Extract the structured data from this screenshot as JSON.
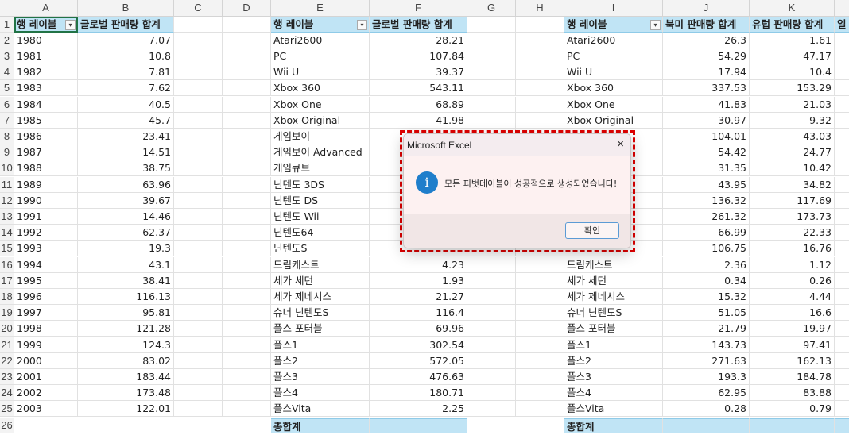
{
  "columns": [
    "A",
    "B",
    "C",
    "D",
    "E",
    "F",
    "G",
    "H",
    "I",
    "J",
    "K",
    "L"
  ],
  "row_numbers": [
    1,
    2,
    3,
    4,
    5,
    6,
    7,
    8,
    9,
    10,
    11,
    12,
    13,
    14,
    15,
    16,
    17,
    18,
    19,
    20,
    21,
    22,
    23,
    24,
    25,
    26
  ],
  "pivot1": {
    "headers": [
      "행 레이블",
      "글로벌 판매량 합계"
    ],
    "rows": [
      [
        "1980",
        "7.07"
      ],
      [
        "1981",
        "10.8"
      ],
      [
        "1982",
        "7.81"
      ],
      [
        "1983",
        "7.62"
      ],
      [
        "1984",
        "40.5"
      ],
      [
        "1985",
        "45.7"
      ],
      [
        "1986",
        "23.41"
      ],
      [
        "1987",
        "14.51"
      ],
      [
        "1988",
        "38.75"
      ],
      [
        "1989",
        "63.96"
      ],
      [
        "1990",
        "39.67"
      ],
      [
        "1991",
        "14.46"
      ],
      [
        "1992",
        "62.37"
      ],
      [
        "1993",
        "19.3"
      ],
      [
        "1994",
        "43.1"
      ],
      [
        "1995",
        "38.41"
      ],
      [
        "1996",
        "116.13"
      ],
      [
        "1997",
        "95.81"
      ],
      [
        "1998",
        "121.28"
      ],
      [
        "1999",
        "124.3"
      ],
      [
        "2000",
        "83.02"
      ],
      [
        "2001",
        "183.44"
      ],
      [
        "2002",
        "173.48"
      ],
      [
        "2003",
        "122.01"
      ]
    ]
  },
  "pivot2": {
    "headers": [
      "행 레이블",
      "글로벌 판매량 합계"
    ],
    "rows": [
      [
        "Atari2600",
        "28.21"
      ],
      [
        "PC",
        "107.84"
      ],
      [
        "Wii U",
        "39.37"
      ],
      [
        "Xbox 360",
        "543.11"
      ],
      [
        "Xbox One",
        "68.89"
      ],
      [
        "Xbox Original",
        "41.98"
      ],
      [
        "게임보이",
        ""
      ],
      [
        "게임보이 Advanced",
        ""
      ],
      [
        "게임큐브",
        ""
      ],
      [
        "닌텐도 3DS",
        ""
      ],
      [
        "닌텐도 DS",
        ""
      ],
      [
        "닌텐도 Wii",
        ""
      ],
      [
        "닌텐도64",
        ""
      ],
      [
        "닌텐도S",
        ""
      ],
      [
        "드림캐스트",
        "4.23"
      ],
      [
        "세가 세턴",
        "1.93"
      ],
      [
        "세가 제네시스",
        "21.27"
      ],
      [
        "슈너 닌텐도S",
        "116.4"
      ],
      [
        "플스 포터블",
        "69.96"
      ],
      [
        "플스1",
        "302.54"
      ],
      [
        "플스2",
        "572.05"
      ],
      [
        "플스3",
        "476.63"
      ],
      [
        "플스4",
        "180.71"
      ],
      [
        "플스Vita",
        "2.25"
      ]
    ],
    "total_label": "총합계"
  },
  "pivot3": {
    "headers": [
      "행 레이블",
      "북미 판매량 합계",
      "유럽 판매량 합계",
      "일"
    ],
    "rows": [
      [
        "Atari2600",
        "26.3",
        "1.61"
      ],
      [
        "PC",
        "54.29",
        "47.17"
      ],
      [
        "Wii U",
        "17.94",
        "10.4"
      ],
      [
        "Xbox 360",
        "337.53",
        "153.29"
      ],
      [
        "Xbox One",
        "41.83",
        "21.03"
      ],
      [
        "Xbox Original",
        "30.97",
        "9.32"
      ],
      [
        "",
        "104.01",
        "43.03"
      ],
      [
        "",
        "54.42",
        "24.77"
      ],
      [
        "",
        "31.35",
        "10.42"
      ],
      [
        "",
        "43.95",
        "34.82"
      ],
      [
        "",
        "136.32",
        "117.69"
      ],
      [
        "",
        "261.32",
        "173.73"
      ],
      [
        "",
        "66.99",
        "22.33"
      ],
      [
        "",
        "106.75",
        "16.76"
      ],
      [
        "드림캐스트",
        "2.36",
        "1.12"
      ],
      [
        "세가 세턴",
        "0.34",
        "0.26"
      ],
      [
        "세가 제네시스",
        "15.32",
        "4.44"
      ],
      [
        "슈너 닌텐도S",
        "51.05",
        "16.6"
      ],
      [
        "플스 포터블",
        "21.79",
        "19.97"
      ],
      [
        "플스1",
        "143.73",
        "97.41"
      ],
      [
        "플스2",
        "271.63",
        "162.13"
      ],
      [
        "플스3",
        "193.3",
        "184.78"
      ],
      [
        "플스4",
        "62.95",
        "83.88"
      ],
      [
        "플스Vita",
        "0.28",
        "0.79"
      ]
    ],
    "total_label": "총합계"
  },
  "dialog": {
    "title": "Microsoft Excel",
    "close_icon": "×",
    "info_icon": "i",
    "message": "모든 피벗테이블이 성공적으로 생성되었습니다!",
    "ok_label": "확인"
  },
  "colors": {
    "pivot_header": "#c0e4f5",
    "highlight_frame": "#e00000",
    "info_icon": "#1f7ecb"
  }
}
